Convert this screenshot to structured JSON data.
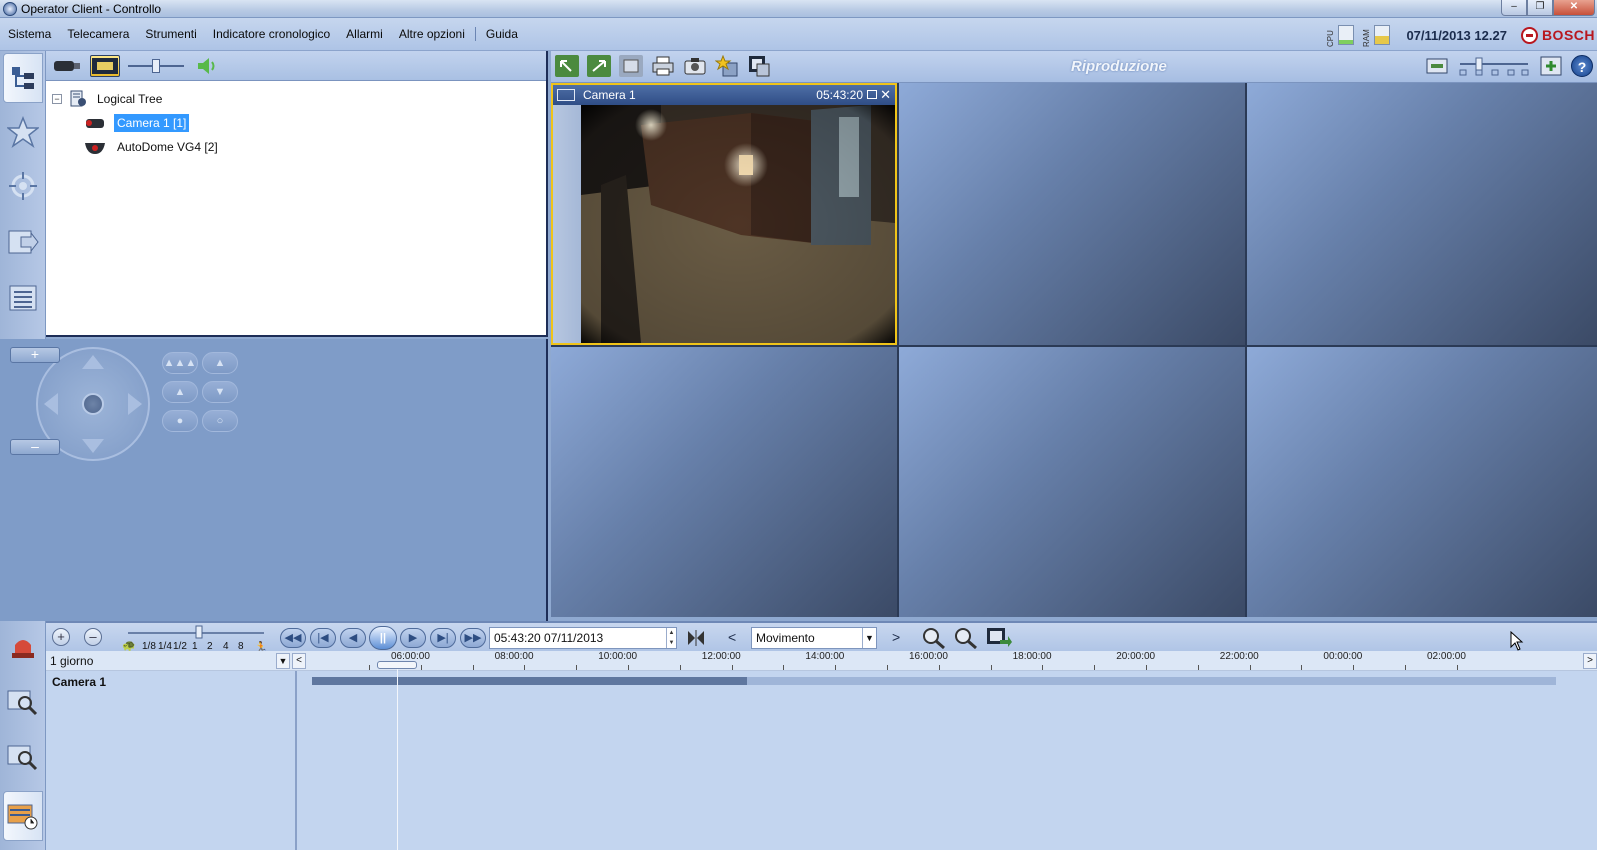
{
  "window": {
    "title": "Operator Client - Controllo"
  },
  "menu": [
    "Sistema",
    "Telecamera",
    "Strumenti",
    "Indicatore cronologico",
    "Allarmi",
    "Altre opzioni",
    "Guida"
  ],
  "status": {
    "cpu_label": "CPU",
    "ram_label": "RAM",
    "cpu_level": 0.25,
    "ram_level": 0.45,
    "datetime": "07/11/2013 12.27",
    "brand": "BOSCH"
  },
  "tree": {
    "root": "Logical Tree",
    "items": [
      {
        "label": "Camera 1 [1]",
        "selected": true
      },
      {
        "label": "AutoDome VG4 [2]",
        "selected": false
      }
    ]
  },
  "viewer": {
    "mode": "Riproduzione"
  },
  "camera_tile": {
    "name": "Camera 1",
    "time": "05:43:20"
  },
  "timeline": {
    "speeds": [
      "1/8",
      "1/4",
      "1/2",
      "1",
      "2",
      "4",
      "8"
    ],
    "time_value": "05:43:20  07/11/2013",
    "search_filter": "Movimento",
    "range": "1 giorno",
    "ticks": [
      "06:00:00",
      "08:00:00",
      "10:00:00",
      "12:00:00",
      "14:00:00",
      "16:00:00",
      "18:00:00",
      "20:00:00",
      "22:00:00",
      "00:00:00",
      "02:00:00"
    ],
    "track_name": "Camera 1",
    "recording_fraction": 0.35
  },
  "colors": {
    "accent": "#f0c419",
    "selection": "#3399ff",
    "brand": "#b8171f"
  }
}
